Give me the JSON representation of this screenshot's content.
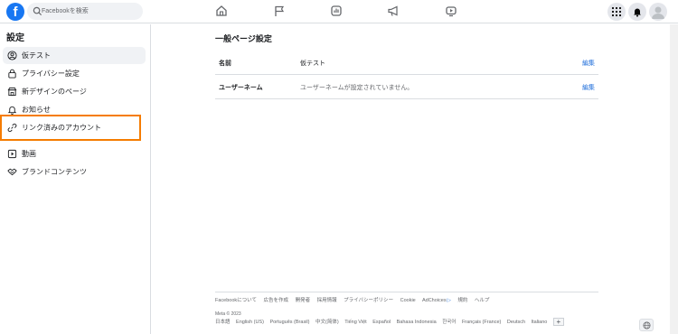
{
  "topbar": {
    "logo_letter": "f",
    "search_placeholder": "Facebookを検索",
    "nav_icons": [
      "home-icon",
      "flag-icon",
      "news-feed-icon",
      "megaphone-icon",
      "video-icon"
    ],
    "right_icons": [
      "menu-grid-icon",
      "notification-bell-icon",
      "account-avatar"
    ]
  },
  "sidebar": {
    "title": "設定",
    "items": [
      {
        "label": "仮テスト",
        "icon": "profile-icon",
        "active": true
      },
      {
        "label": "プライバシー設定",
        "icon": "lock-icon"
      },
      {
        "label": "新デザインのページ",
        "icon": "pages-icon"
      },
      {
        "label": "お知らせ",
        "icon": "bell-icon"
      },
      {
        "label": "リンク済みのアカウント",
        "icon": "link-icon",
        "highlighted": true
      },
      {
        "label": "動画",
        "icon": "video-icon"
      },
      {
        "label": "ブランドコンテンツ",
        "icon": "handshake-icon"
      }
    ],
    "highlight_color": "#f57c00"
  },
  "main": {
    "title": "一般ページ設定",
    "rows": [
      {
        "key": "名前",
        "value": "仮テスト",
        "edit": "編集"
      },
      {
        "key": "ユーザーネーム",
        "value": "ユーザーネームが設定されていません。",
        "edit": "編集"
      }
    ]
  },
  "footer": {
    "links": [
      "Facebookについて",
      "広告を作成",
      "開発者",
      "採用情報",
      "プライバシーポリシー",
      "Cookie",
      "AdChoices",
      "規約",
      "ヘルプ"
    ],
    "copyright": "Meta © 2023",
    "languages": [
      "日本語",
      "English (US)",
      "Português (Brasil)",
      "中文(简体)",
      "Tiếng Việt",
      "Español",
      "Bahasa Indonesia",
      "한국어",
      "Français (France)",
      "Deutsch",
      "Italiano"
    ],
    "more_languages": "+"
  },
  "colors": {
    "brand": "#1877f2",
    "link": "#216fdb",
    "highlight": "#f57c00"
  }
}
